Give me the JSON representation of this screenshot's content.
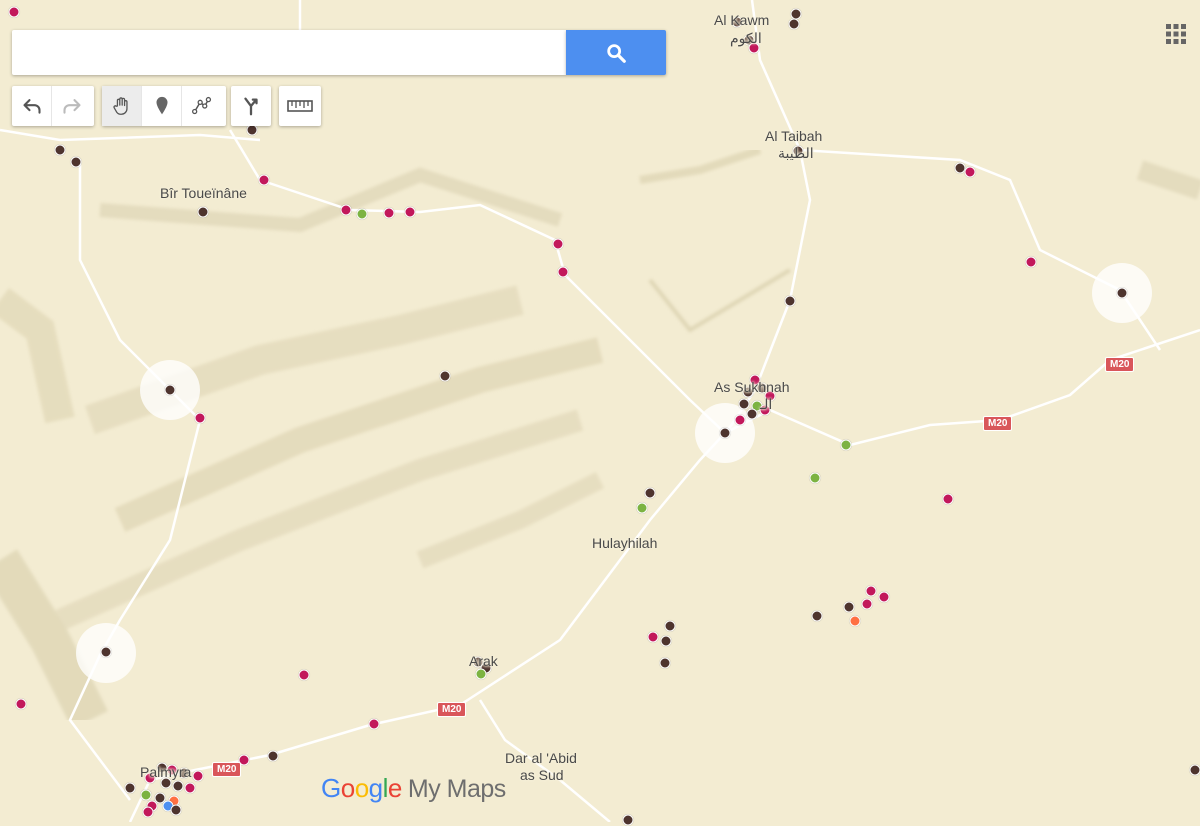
{
  "search": {
    "placeholder": "",
    "value": ""
  },
  "toolbar": {
    "undo": "undo-icon",
    "redo": "redo-icon",
    "pan": "hand-icon",
    "marker": "marker-icon",
    "line": "line-icon",
    "directions": "directions-icon",
    "measure": "ruler-icon"
  },
  "places": {
    "al_kawm": "Al Kawm",
    "al_kawm_ar": "الكوم",
    "al_taibah": "Al Taibah",
    "al_taibah_ar": "الطيبة",
    "bir_toueinane": "Bîr Toueïnâne",
    "as_sukhnah": "As Sukhnah",
    "as_sukhnah_ar": "الـ",
    "hulayhilah": "Hulayhilah",
    "arak": "Arak",
    "dar_al_abid_1": "Dar al 'Abid",
    "dar_al_abid_2": "as Sud",
    "palmyra": "Palmyra"
  },
  "roads": {
    "m20": "M20"
  },
  "logo": {
    "google": "Google",
    "product": "My Maps"
  },
  "colors": {
    "land": "#f3ecd2",
    "road": "#ffffff",
    "accent": "#4d8ff0",
    "pin_magenta": "#c2185b",
    "pin_brown": "#4e342e",
    "pin_green": "#7cb342",
    "pin_orange": "#ff7043",
    "road_shield": "#d9565a"
  }
}
